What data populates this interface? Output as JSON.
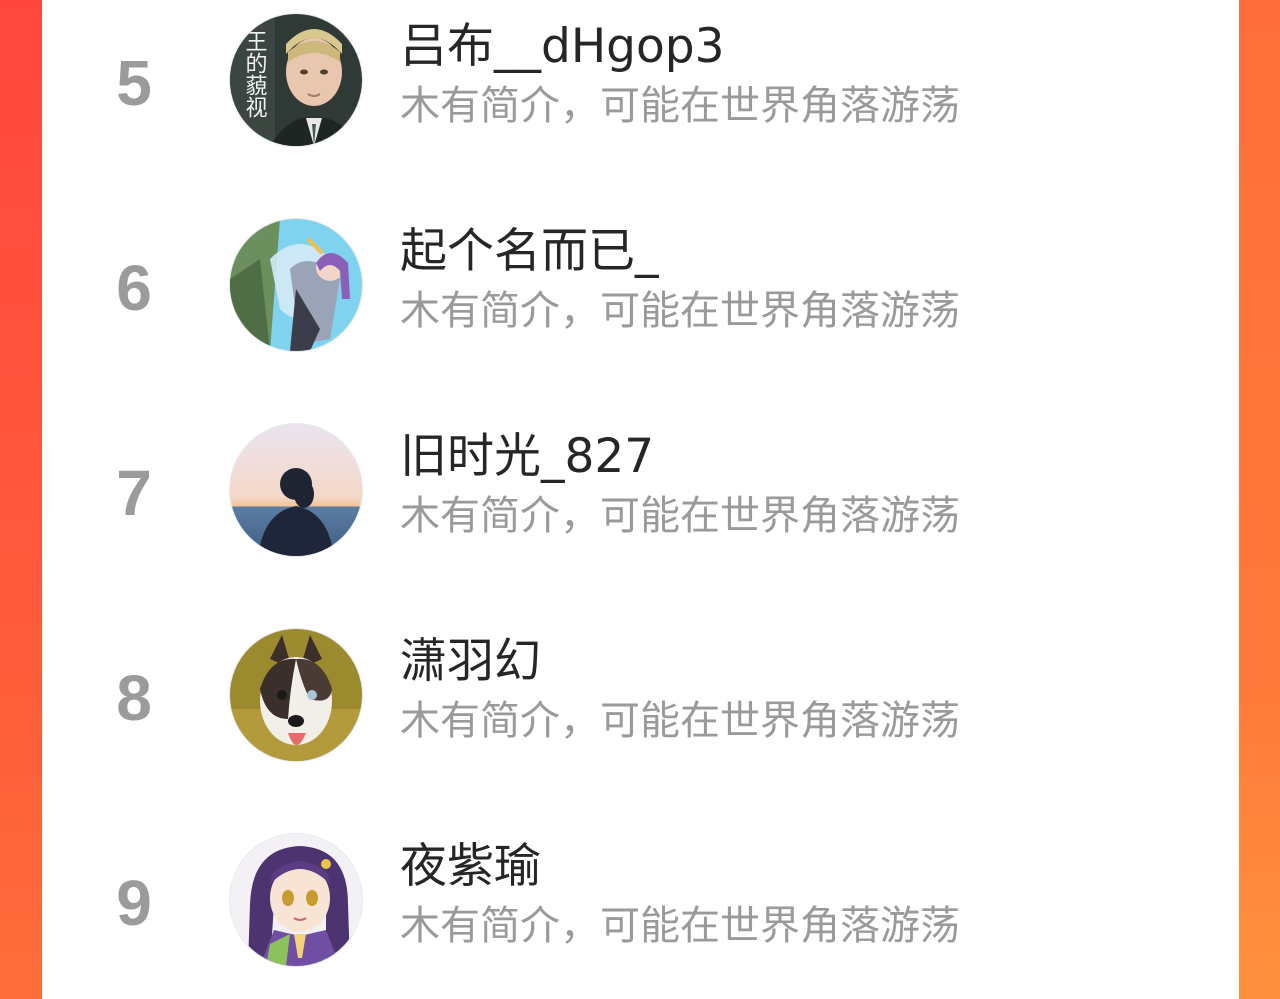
{
  "rank_list": {
    "rows": [
      {
        "rank": "5",
        "name": "吕布__dHgop3",
        "bio": "木有简介，可能在世界角落游荡",
        "avatar_icon": "avatar-portrait-with-text",
        "avatar_text": "王的藐视"
      },
      {
        "rank": "6",
        "name": "起个名而已_",
        "bio": "木有简介，可能在世界角落游荡",
        "avatar_icon": "avatar-anime-girl-fairy"
      },
      {
        "rank": "7",
        "name": "旧时光_827",
        "bio": "木有简介，可能在世界角落游荡",
        "avatar_icon": "avatar-silhouette-sunset"
      },
      {
        "rank": "8",
        "name": "潇羽幻",
        "bio": "木有简介，可能在世界角落游荡",
        "avatar_icon": "avatar-husky-dog"
      },
      {
        "rank": "9",
        "name": "夜紫瑜",
        "bio": "木有简介，可能在世界角落游荡",
        "avatar_icon": "avatar-anime-girl-purple-hair"
      }
    ]
  },
  "colors": {
    "rank_number": "#9b9b9b",
    "name_text": "#262626",
    "bio_text": "#9a9a9a",
    "frame_left": "#ff473e",
    "frame_right": "#ff7b3a",
    "panel_background": "#ffffff"
  }
}
